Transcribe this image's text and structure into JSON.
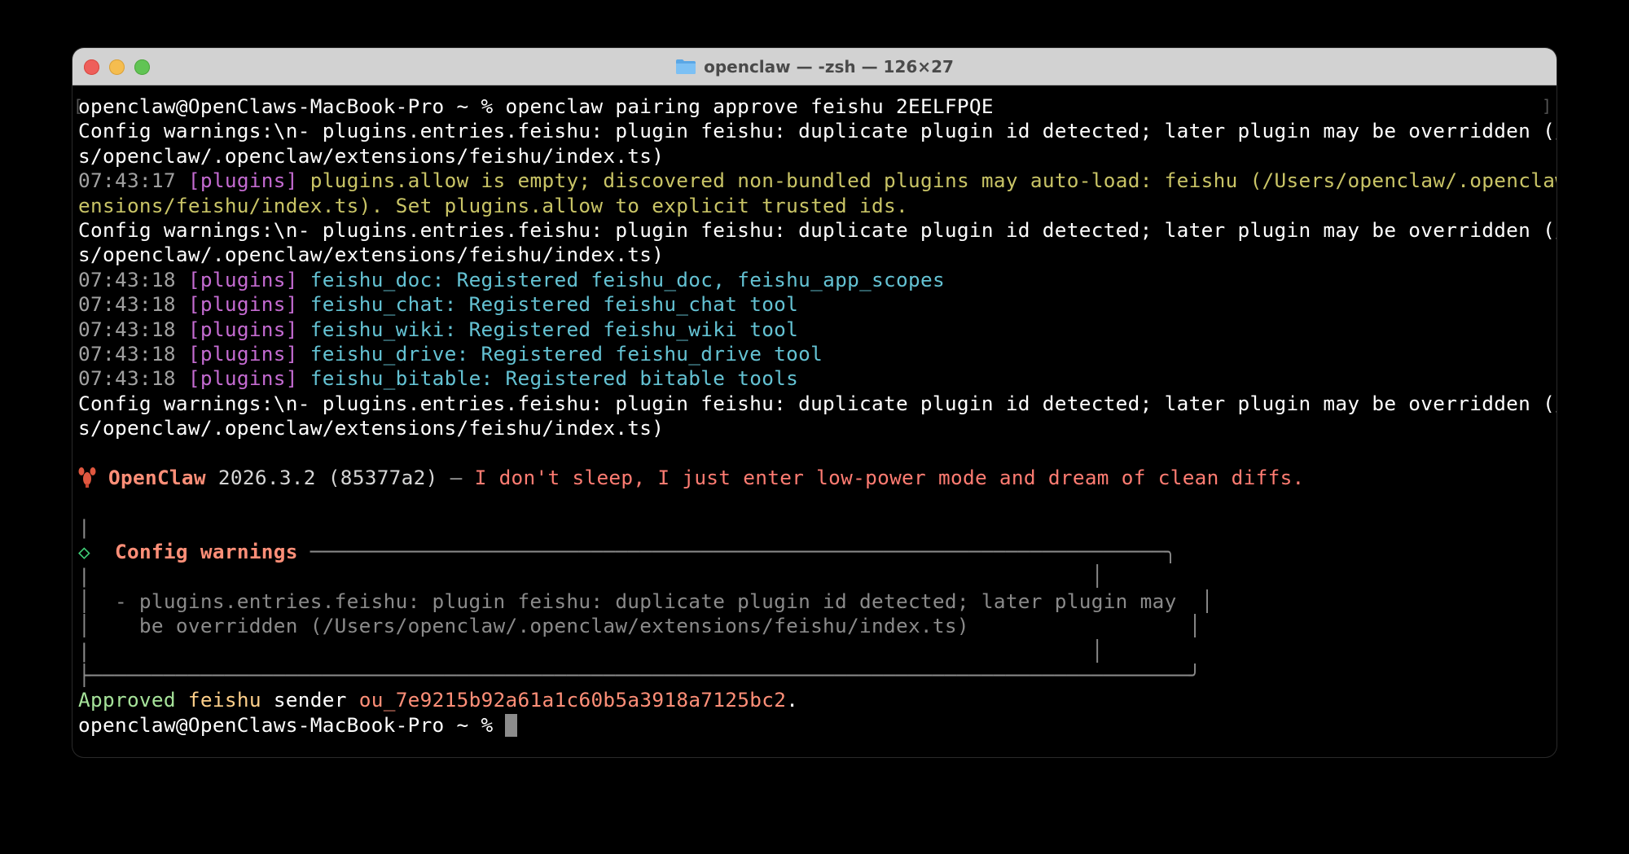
{
  "window": {
    "title": "openclaw — -zsh — 126×27"
  },
  "terminal": {
    "prompt": "openclaw@OpenClaws-MacBook-Pro ~ % ",
    "command": "openclaw pairing approve feishu 2EELFPQE",
    "config_warning_a": "Config warnings:\\n- plugins.entries.feishu: plugin feishu: duplicate plugin id detected; later plugin may be overridden (/User",
    "config_warning_b": "s/openclaw/.openclaw/extensions/feishu/index.ts)",
    "allow_time": "07:43:17",
    "plugins_tag": "[plugins]",
    "allow_msg_a": "plugins.allow is empty; discovered non-bundled plugins may auto-load: feishu (/Users/openclaw/.openclaw/ext",
    "allow_msg_b": "ensions/feishu/index.ts). Set plugins.allow to explicit trusted ids.",
    "registrations": [
      {
        "time": "07:43:18",
        "tag": "[plugins]",
        "msg": "feishu_doc: Registered feishu_doc, feishu_app_scopes"
      },
      {
        "time": "07:43:18",
        "tag": "[plugins]",
        "msg": "feishu_chat: Registered feishu_chat tool"
      },
      {
        "time": "07:43:18",
        "tag": "[plugins]",
        "msg": "feishu_wiki: Registered feishu_wiki tool"
      },
      {
        "time": "07:43:18",
        "tag": "[plugins]",
        "msg": "feishu_drive: Registered feishu_drive tool"
      },
      {
        "time": "07:43:18",
        "tag": "[plugins]",
        "msg": "feishu_bitable: Registered bitable tools"
      }
    ],
    "banner": {
      "icon": "lobster-icon",
      "name": "OpenClaw",
      "version": "2026.3.2 (85377a2)",
      "dash": " — ",
      "tagline": "I don't sleep, I just enter low-power mode and dream of clean diffs."
    },
    "panel": {
      "bar": "|",
      "diamond": "◇",
      "title": "Config warnings",
      "top_rule": " ──────────────────────────────────────────────────────────────────────╮",
      "blank_row": "│                                                                                  │",
      "blank_row_top": "|                                                                                  │",
      "line1": "│  - plugins.entries.feishu: plugin feishu: duplicate plugin id detected; later plugin may  │",
      "line2": "│    be overridden (/Users/openclaw/.openclaw/extensions/feishu/index.ts)                  │",
      "blank_row_bottom": "|                                                                                  │",
      "bottom_rule": "├──────────────────────────────────────────────────────────────────────────────────────────╯"
    },
    "approved": {
      "word": "Approved",
      "channel": "feishu",
      "sender": "sender",
      "id": "ou_7e9215b92a61a1c60b5a3918a7125bc2",
      "period": "."
    },
    "final_prompt": "openclaw@OpenClaws-MacBook-Pro ~ % "
  },
  "colors": {
    "magenta": "#c46bd1",
    "yellow": "#c9c466",
    "cyan": "#64c2d3",
    "orange": "#ff8f78",
    "green": "#a6e39a"
  }
}
